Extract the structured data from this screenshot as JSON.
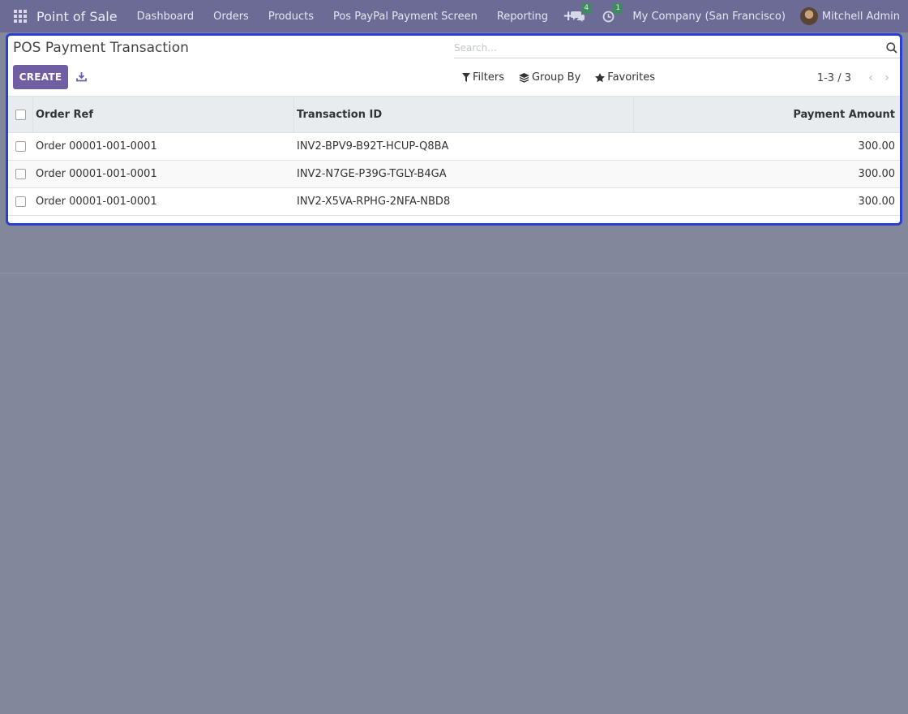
{
  "navbar": {
    "app_name": "Point of Sale",
    "menu": [
      "Dashboard",
      "Orders",
      "Products",
      "Pos PayPal Payment Screen",
      "Reporting"
    ],
    "messages_count": "4",
    "activities_count": "1",
    "company": "My Company (San Francisco)",
    "user": "Mitchell Admin"
  },
  "control_panel": {
    "title": "POS Payment Transaction",
    "search_placeholder": "Search...",
    "create_label": "CREATE",
    "filters_label": "Filters",
    "group_by_label": "Group By",
    "favorites_label": "Favorites",
    "pager": "1-3 / 3"
  },
  "table": {
    "columns": [
      "Order Ref",
      "Transaction ID",
      "Payment Amount"
    ],
    "rows": [
      {
        "order_ref": "Order 00001-001-0001",
        "transaction_id": "INV2-BPV9-B92T-HCUP-Q8BA",
        "amount": "300.00"
      },
      {
        "order_ref": "Order 00001-001-0001",
        "transaction_id": "INV2-N7GE-P39G-TGLY-B4GA",
        "amount": "300.00"
      },
      {
        "order_ref": "Order 00001-001-0001",
        "transaction_id": "INV2-X5VA-RPHG-2NFA-NBD8",
        "amount": "300.00"
      }
    ]
  },
  "colors": {
    "navbar": "#6b6b96",
    "primary_button": "#6f5ea1",
    "highlight_border": "#2940d3",
    "backdrop": "#83879c"
  }
}
